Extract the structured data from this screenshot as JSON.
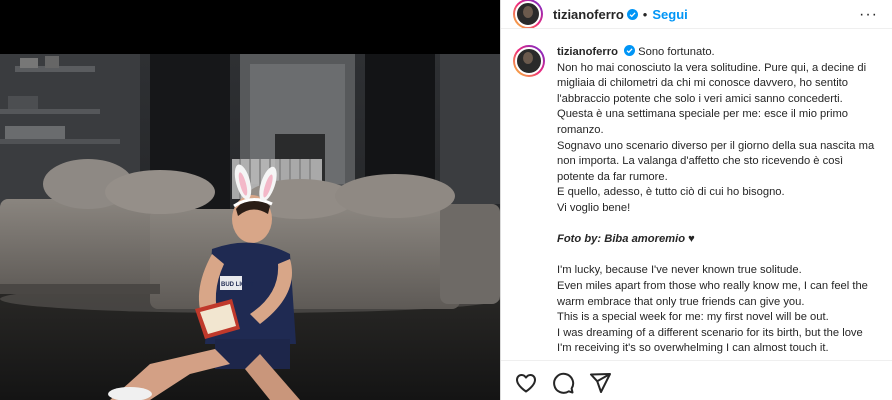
{
  "post": {
    "username": "tizianoferro",
    "follow_label": "Segui",
    "separator": "•",
    "more_label": "···",
    "caption": {
      "username": "tizianoferro",
      "lines_it": [
        "Sono fortunato.",
        "Non ho mai conosciuto la vera solitudine. Pure qui, a decine di",
        "migliaia di chilometri da chi mi conosce davvero, ho sentito",
        "l'abbraccio potente che solo i veri amici sanno concederti.",
        "Questa è una settimana speciale per me: esce il mio primo",
        "romanzo.",
        "Sognavo uno scenario diverso per il giorno della sua nascita ma",
        "non importa. La valanga d'affetto che sto ricevendo è così",
        "potente da far rumore.",
        "E quello, adesso, è tutto ciò di cui ho bisogno.",
        "Vi voglio bene!"
      ],
      "photo_credit_label": "Foto by:",
      "photo_credit_name": "Biba amoremio ♥",
      "lines_en": [
        "I'm lucky, because I've never known true solitude.",
        "Even miles apart from those who really know me, I can feel the",
        "warm embrace that only true friends can give you.",
        "This is a special week for me: my first novel will be out.",
        "I was dreaming of a different scenario for its birth, but the love",
        "I'm receiving it's so overwhelming I can almost touch it."
      ]
    }
  },
  "photo": {
    "shirt_text": "BUD LIGHT"
  },
  "icons": {
    "verified": "verified-badge-icon",
    "like": "heart-icon",
    "comment": "comment-icon",
    "share": "share-icon"
  },
  "colors": {
    "link": "#0095f6",
    "verified": "#0095f6",
    "text": "#262626"
  }
}
